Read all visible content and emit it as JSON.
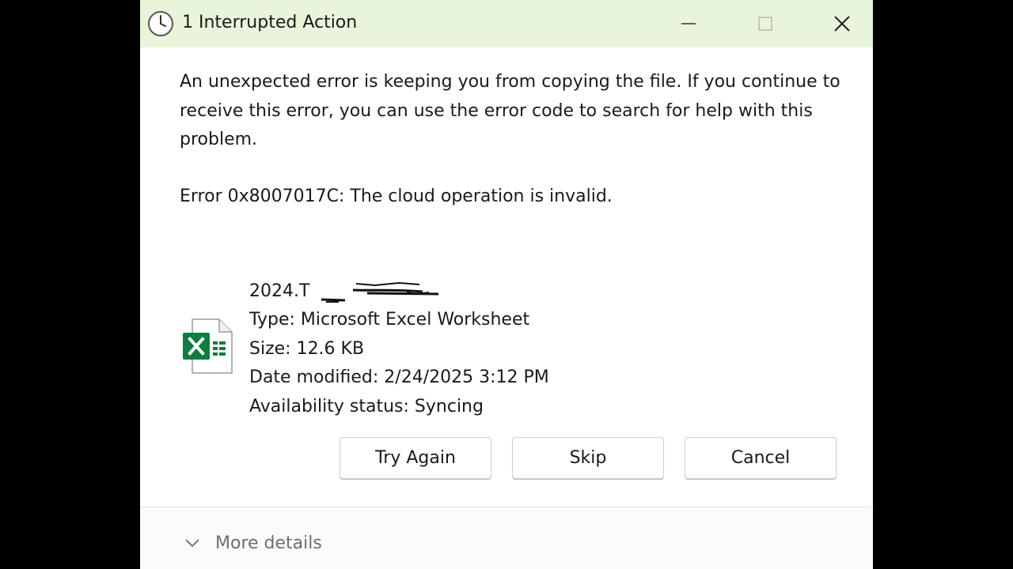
{
  "window": {
    "title": "1 Interrupted Action",
    "icon": "clock-icon",
    "titlebar_color": "#e8f5da",
    "controls": [
      "minimize-icon",
      "maximize-icon",
      "close-icon"
    ]
  },
  "message": {
    "body": "An unexpected error is keeping you from copying the file. If you continue to receive this error, you can use the error code to search for help with this problem.",
    "error": "Error 0x8007017C: The cloud operation is invalid."
  },
  "file": {
    "icon": "excel-file-icon",
    "icon_color": "#107c41",
    "name_visible": "2024.T",
    "type": "Type: Microsoft Excel Worksheet",
    "size": "Size: 12.6 KB",
    "date_modified": "Date modified: 2/24/2025 3:12 PM",
    "availability": "Availability status: Syncing"
  },
  "buttons": {
    "try_again": "Try Again",
    "skip": "Skip",
    "cancel": "Cancel"
  },
  "footer": {
    "more_details": "More details"
  }
}
